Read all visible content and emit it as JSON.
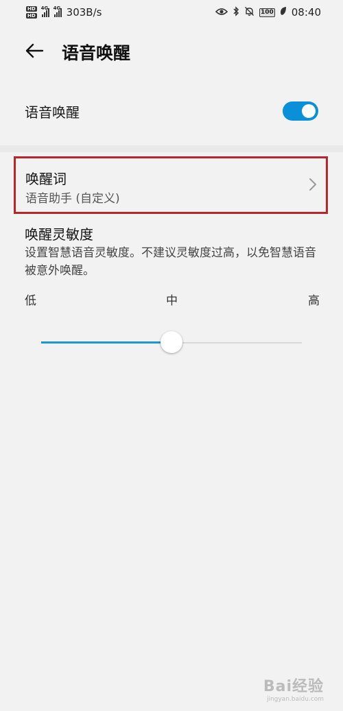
{
  "status_bar": {
    "hd_labels": [
      "HD",
      "HD"
    ],
    "network_1": "4G",
    "network_2": "4G",
    "speed": "303B/s",
    "battery": "100",
    "time": "08:40",
    "icons": [
      "eye-icon",
      "bluetooth-icon",
      "bell-muted-icon",
      "leaf-icon"
    ]
  },
  "header": {
    "title": "语音唤醒",
    "back_icon": "arrow-left-icon"
  },
  "voice_wake": {
    "label": "语音唤醒",
    "enabled": true
  },
  "wake_word": {
    "title": "唤醒词",
    "value": "语音助手 (自定义)",
    "highlight_color": "#b8262b"
  },
  "sensitivity": {
    "title": "唤醒灵敏度",
    "description": "设置智慧语音灵敏度。不建议灵敏度过高，以免智慧语音被意外唤醒。",
    "low_label": "低",
    "mid_label": "中",
    "high_label": "高",
    "level": 0.5
  },
  "colors": {
    "accent": "#0a8fd9",
    "background": "#f2f2f2"
  },
  "watermark": {
    "main": "Bai经验",
    "sub": "jingyan.baidu.com"
  }
}
